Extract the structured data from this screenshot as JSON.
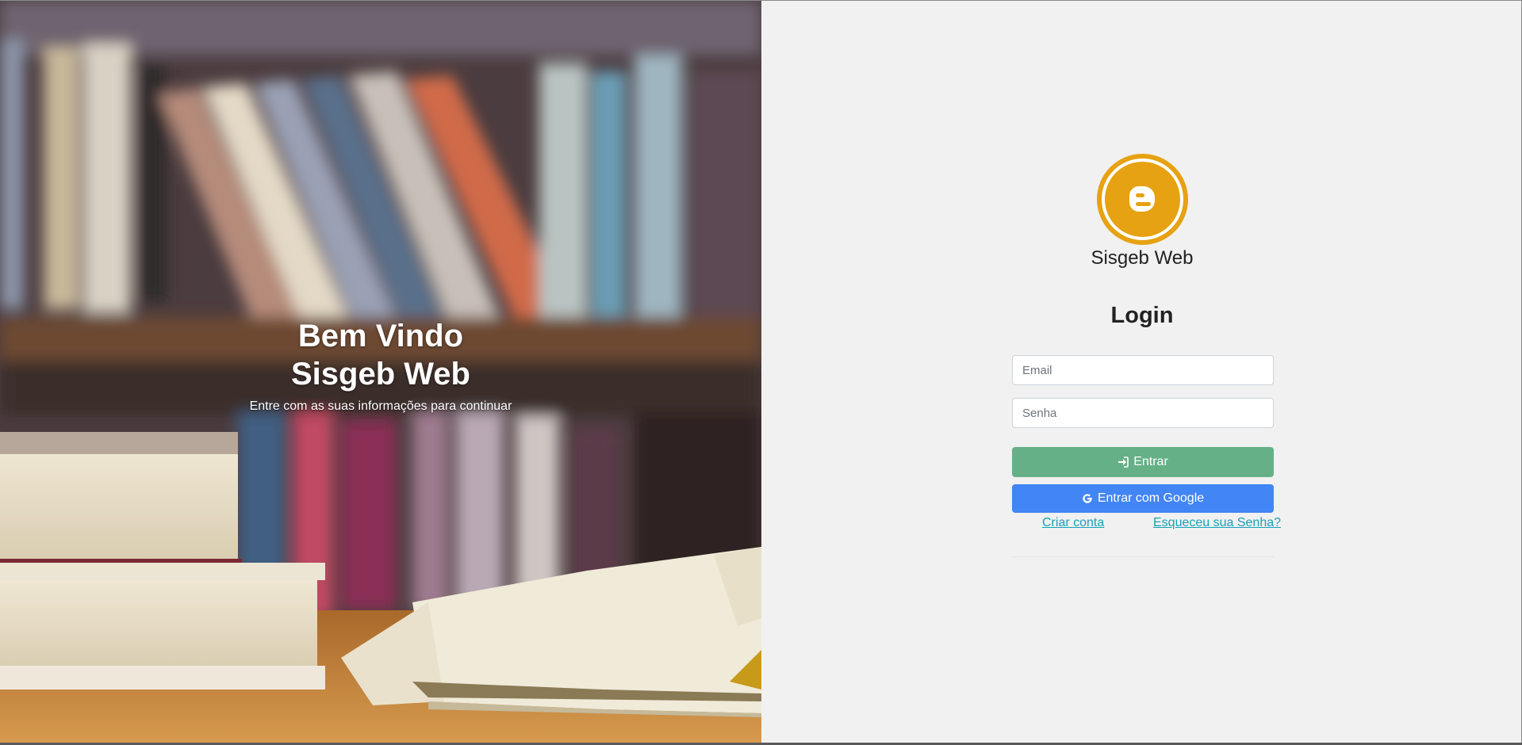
{
  "hero": {
    "title_line1": "Bem Vindo",
    "title_line2": "Sisgeb Web",
    "subtitle": "Entre com as suas informações para continuar"
  },
  "login": {
    "logo_icon": "blogger-icon",
    "brand": "Sisgeb Web",
    "heading": "Login",
    "email_placeholder": "Email",
    "password_placeholder": "Senha",
    "entrar_label": "Entrar",
    "entrar_icon": "sign-in-icon",
    "google_label": "Entrar com Google",
    "google_icon": "google-icon",
    "criar_conta": "Criar conta",
    "esqueceu_senha": "Esqueceu sua Senha?"
  },
  "colors": {
    "logo": "#e6a212",
    "entrar_button": "#66b088",
    "google_button": "#4285f4",
    "link": "#17a2b8",
    "panel_background": "#f1f1f1"
  }
}
